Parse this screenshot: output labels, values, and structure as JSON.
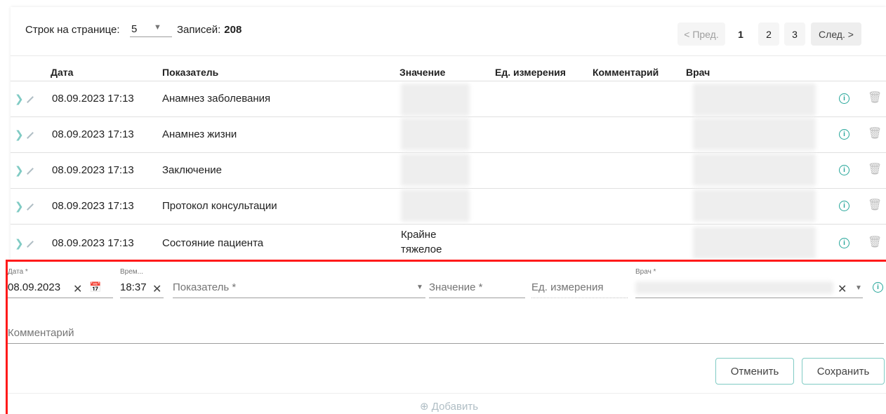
{
  "toolbar": {
    "rows_per_page_label": "Строк на странице:",
    "rows_per_page_value": "5",
    "records_label": "Записей:",
    "records_count": "208"
  },
  "pagination": {
    "prev": "< Пред.",
    "pages": [
      "1",
      "2",
      "3"
    ],
    "active_page": "1",
    "next": "След. >"
  },
  "table": {
    "columns": [
      "Дата",
      "Показатель",
      "Значение",
      "Ед. измерения",
      "Комментарий",
      "Врач"
    ],
    "rows": [
      {
        "date": "08.09.2023 17:13",
        "indicator": "Анамнез заболевания",
        "value_line1": "",
        "value_line2": ""
      },
      {
        "date": "08.09.2023 17:13",
        "indicator": "Анамнез жизни",
        "value_line1": "",
        "value_line2": ""
      },
      {
        "date": "08.09.2023 17:13",
        "indicator": "Заключение",
        "value_line1": "",
        "value_line2": ""
      },
      {
        "date": "08.09.2023 17:13",
        "indicator": "Протокол консультации",
        "value_line1": "",
        "value_line2": ""
      },
      {
        "date": "08.09.2023 17:13",
        "indicator": "Состояние пациента",
        "value_line1": "Крайне",
        "value_line2": "тяжелое"
      }
    ]
  },
  "form": {
    "date_label": "Дата *",
    "date_value": "08.09.2023",
    "time_label": "Врем...",
    "time_value": "18:37",
    "indicator_placeholder": "Показатель *",
    "value_placeholder": "Значение *",
    "unit_placeholder": "Ед. измерения",
    "doctor_label": "Врач *",
    "comment_placeholder": "Комментарий",
    "cancel": "Отменить",
    "save": "Сохранить",
    "add": "Добавить"
  },
  "colors": {
    "accent": "#26a69a",
    "highlight_border": "#ff1a1a"
  }
}
